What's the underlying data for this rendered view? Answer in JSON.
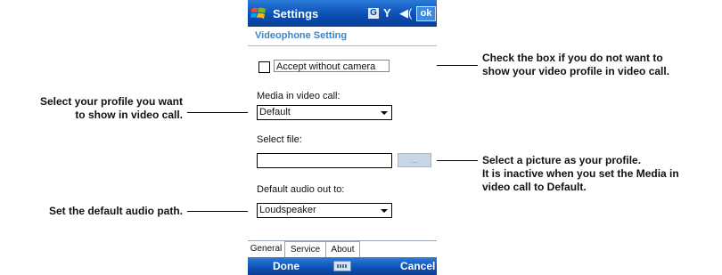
{
  "callouts": {
    "profile": "Select your profile you want\nto show in video call.",
    "audio": "Set the default audio path.",
    "camera": "Check the box if you do not want to\nshow your video profile in video call.",
    "picture": "Select a picture as your profile.\nIt is inactive when you set the Media in\nvideo call to Default."
  },
  "titlebar": {
    "title": "Settings",
    "status_g": "G",
    "ok": "ok"
  },
  "page": {
    "header": "Videophone Setting",
    "accept_label": "Accept without camera",
    "media_label": "Media in video call:",
    "media_value": "Default",
    "file_label": "Select file:",
    "file_value": "",
    "browse_label": "...",
    "audio_label": "Default audio out to:",
    "audio_value": "Loudspeaker"
  },
  "tabs": [
    "General",
    "Service",
    "About"
  ],
  "softkeys": {
    "left": "Done",
    "right": "Cancel"
  },
  "icons": [
    "windows-logo-icon",
    "signal-icon",
    "volume-icon",
    "keyboard-icon",
    "dropdown-arrow-icon"
  ]
}
